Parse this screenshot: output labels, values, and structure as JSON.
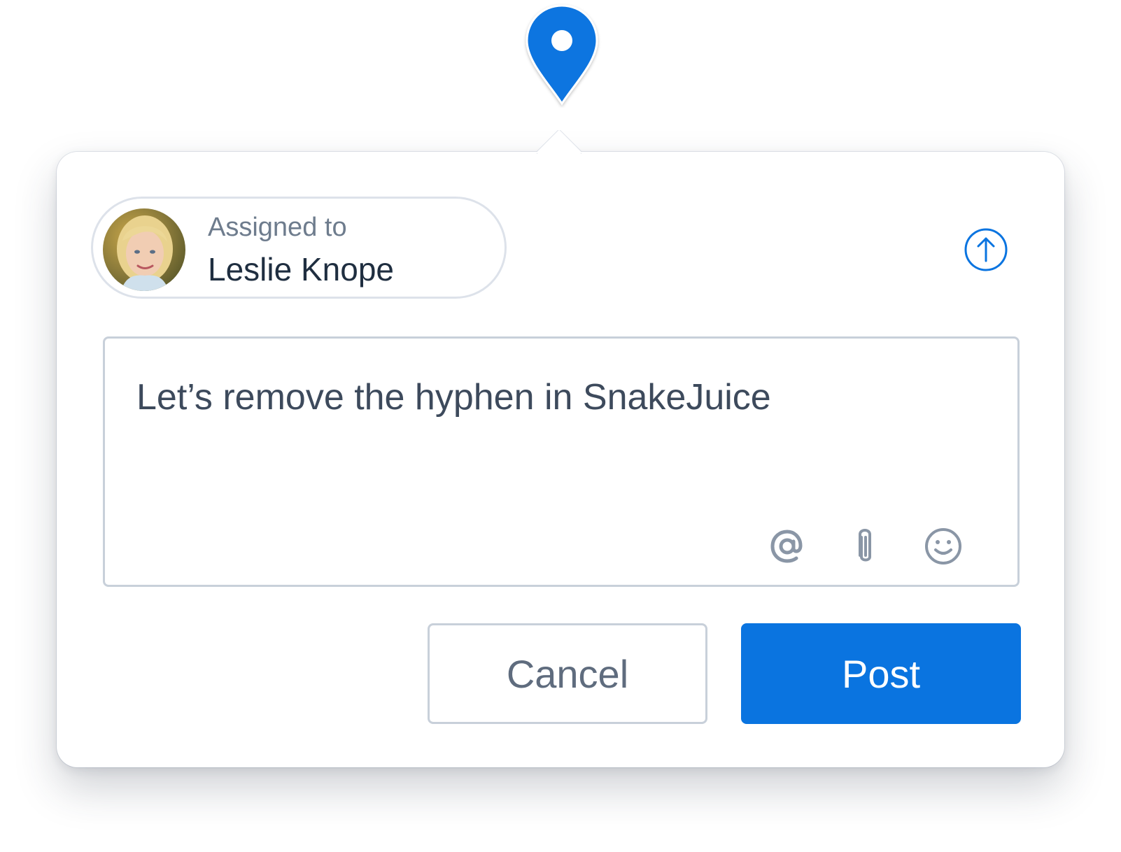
{
  "pin": {
    "icon": "location-pin-icon",
    "color": "#0a74e0"
  },
  "assignee": {
    "label": "Assigned to",
    "name": "Leslie Knope",
    "avatar_icon": "avatar"
  },
  "header_action": {
    "icon": "arrow-up-circle-icon",
    "color": "#0a74e0"
  },
  "comment": {
    "text": "Let’s remove the hyphen in SnakeJuice",
    "tools": [
      {
        "icon": "mention-at-icon"
      },
      {
        "icon": "paperclip-icon"
      },
      {
        "icon": "emoji-icon"
      }
    ]
  },
  "actions": {
    "cancel_label": "Cancel",
    "post_label": "Post"
  },
  "colors": {
    "accent": "#0a74e0",
    "text_primary": "#1f2e40",
    "text_secondary": "#6e7c8d",
    "border": "#c8d0da",
    "icon_gray": "#8a96a6"
  }
}
